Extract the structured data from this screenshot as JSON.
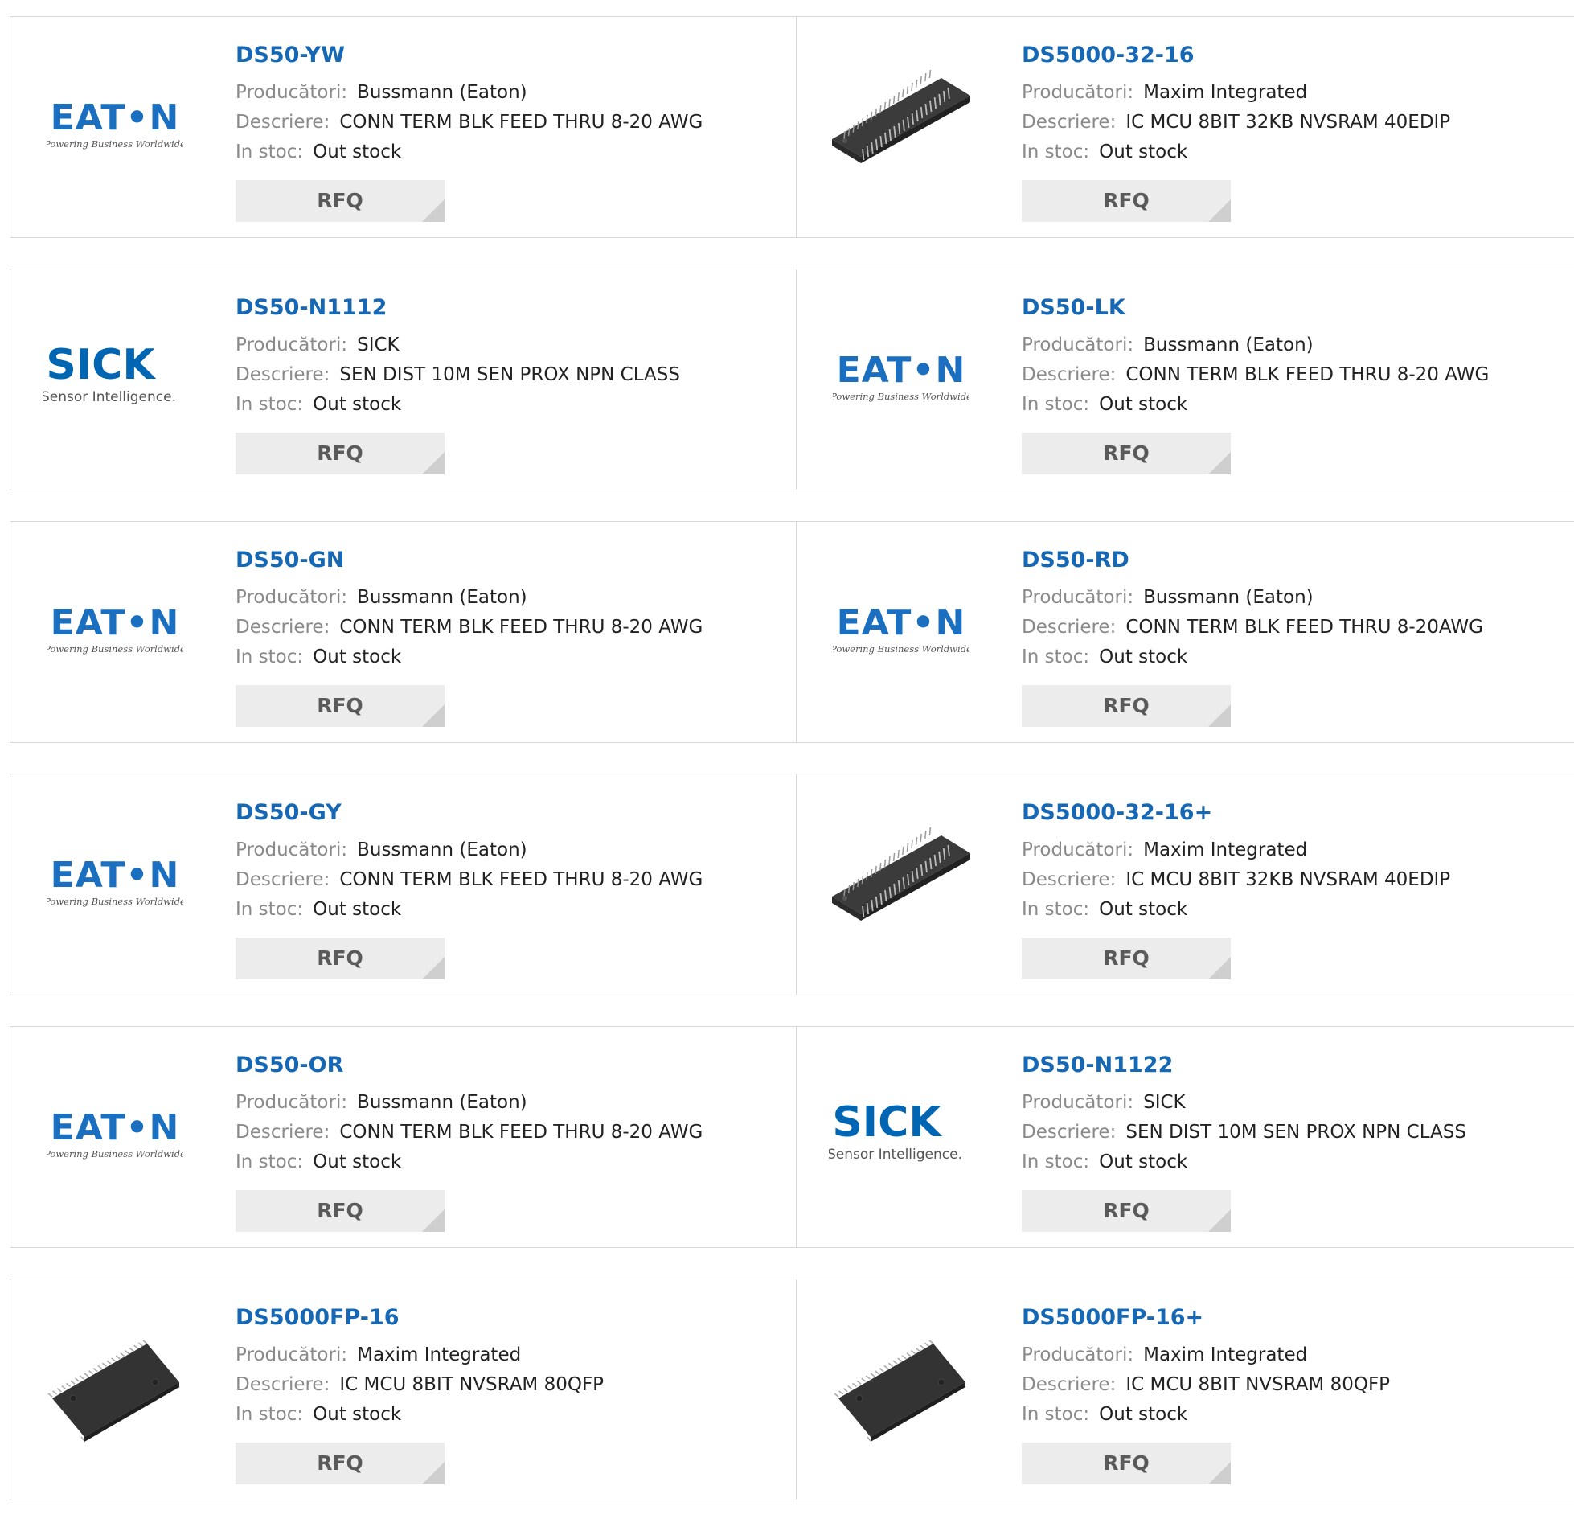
{
  "labels": {
    "manufacturer": "Producători:",
    "description": "Descriere:",
    "stock": "In stoc:",
    "rfq": "RFQ"
  },
  "brands": {
    "eaton": {
      "name": "EAT•N",
      "tagline": "Powering Business Worldwide"
    },
    "sick": {
      "name": "SICK",
      "tagline": "Sensor Intelligence."
    }
  },
  "colors": {
    "link": "#1668b5",
    "eaton_blue": "#1a6fc0",
    "sick_blue": "#0066b3",
    "label_gray": "#8a8a8a",
    "button_bg": "#ececec"
  },
  "products": [
    {
      "name": "DS50-YW",
      "manufacturer": "Bussmann (Eaton)",
      "description": "CONN TERM BLK FEED THRU 8-20 AWG",
      "stock": "Out stock",
      "image": "eaton-logo"
    },
    {
      "name": "DS5000-32-16",
      "manufacturer": "Maxim Integrated",
      "description": "IC MCU 8BIT 32KB NVSRAM 40EDIP",
      "stock": "Out stock",
      "image": "dip-chip"
    },
    {
      "name": "DS50-N1112",
      "manufacturer": "SICK",
      "description": "SEN DIST 10M SEN PROX NPN CLASS",
      "stock": "Out stock",
      "image": "sick-logo"
    },
    {
      "name": "DS50-LK",
      "manufacturer": "Bussmann (Eaton)",
      "description": "CONN TERM BLK FEED THRU 8-20 AWG",
      "stock": "Out stock",
      "image": "eaton-logo"
    },
    {
      "name": "DS50-GN",
      "manufacturer": "Bussmann (Eaton)",
      "description": "CONN TERM BLK FEED THRU 8-20 AWG",
      "stock": "Out stock",
      "image": "eaton-logo"
    },
    {
      "name": "DS50-RD",
      "manufacturer": "Bussmann (Eaton)",
      "description": "CONN TERM BLK FEED THRU 8-20AWG",
      "stock": "Out stock",
      "image": "eaton-logo"
    },
    {
      "name": "DS50-GY",
      "manufacturer": "Bussmann (Eaton)",
      "description": "CONN TERM BLK FEED THRU 8-20 AWG",
      "stock": "Out stock",
      "image": "eaton-logo"
    },
    {
      "name": "DS5000-32-16+",
      "manufacturer": "Maxim Integrated",
      "description": "IC MCU 8BIT 32KB NVSRAM 40EDIP",
      "stock": "Out stock",
      "image": "dip-chip"
    },
    {
      "name": "DS50-OR",
      "manufacturer": "Bussmann (Eaton)",
      "description": "CONN TERM BLK FEED THRU 8-20 AWG",
      "stock": "Out stock",
      "image": "eaton-logo"
    },
    {
      "name": "DS50-N1122",
      "manufacturer": "SICK",
      "description": "SEN DIST 10M SEN PROX NPN CLASS",
      "stock": "Out stock",
      "image": "sick-logo"
    },
    {
      "name": "DS5000FP-16",
      "manufacturer": "Maxim Integrated",
      "description": "IC MCU 8BIT NVSRAM 80QFP",
      "stock": "Out stock",
      "image": "qfp-chip"
    },
    {
      "name": "DS5000FP-16+",
      "manufacturer": "Maxim Integrated",
      "description": "IC MCU 8BIT NVSRAM 80QFP",
      "stock": "Out stock",
      "image": "qfp-chip"
    }
  ]
}
